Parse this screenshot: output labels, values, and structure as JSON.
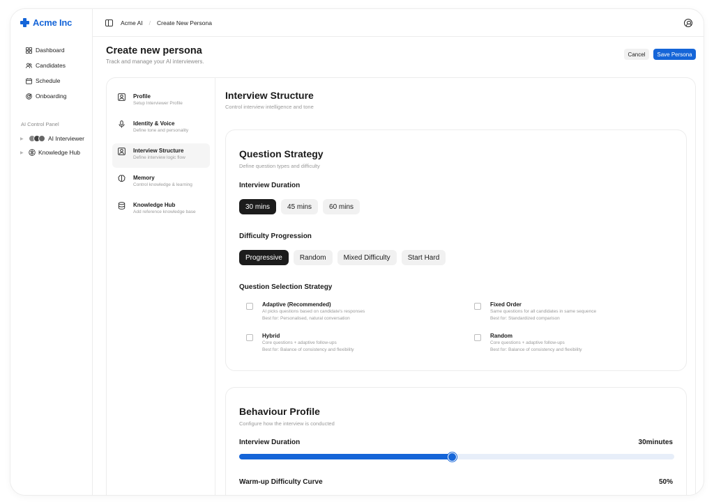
{
  "app": {
    "name": "Acme Inc"
  },
  "sidebar": {
    "nav": [
      {
        "label": "Dashboard",
        "icon": "grid-icon"
      },
      {
        "label": "Candidates",
        "icon": "users-icon"
      },
      {
        "label": "Schedule",
        "icon": "calendar-icon"
      },
      {
        "label": "Onboarding",
        "icon": "target-icon"
      }
    ],
    "panel_label": "AI Control Panel",
    "panel_items": [
      {
        "label": "AI Interviewer",
        "icon": "avatars-icon"
      },
      {
        "label": "Knowledge Hub",
        "icon": "brain-icon"
      }
    ]
  },
  "topbar": {
    "breadcrumbs": [
      "Acme AI",
      "Create New Persona"
    ]
  },
  "header": {
    "title": "Create new persona",
    "subtitle": "Track and manage your AI interviewers.",
    "cancel_label": "Cancel",
    "save_label": "Save Persona"
  },
  "steps": [
    {
      "title": "Profile",
      "desc": "Setup Interviewer Profile",
      "icon": "profile-icon",
      "active": false
    },
    {
      "title": "Identity & Voice",
      "desc": "Define tone and personality",
      "icon": "microphone-icon",
      "active": false
    },
    {
      "title": "Interview Structure",
      "desc": "Define interview logic flow",
      "icon": "structure-icon",
      "active": true
    },
    {
      "title": "Memory",
      "desc": "Control knowledge & learning",
      "icon": "brain-icon",
      "active": false
    },
    {
      "title": "Knowledge Hub",
      "desc": "Add reference knowledge base",
      "icon": "database-icon",
      "active": false
    }
  ],
  "main": {
    "title": "Interview Structure",
    "subtitle": "Control interview intelligence and tone"
  },
  "question_strategy": {
    "title": "Question Strategy",
    "subtitle": "Define question types and difficulty",
    "duration_label": "Interview Duration",
    "durations": [
      "30 mins",
      "45 mins",
      "60 mins"
    ],
    "duration_selected": "30 mins",
    "difficulty_label": "Difficulty Progression",
    "difficulties": [
      "Progressive",
      "Random",
      "Mixed Difficulty",
      "Start Hard"
    ],
    "difficulty_selected": "Progressive",
    "selection_label": "Question Selection Strategy",
    "options": [
      {
        "title": "Adaptive (Recommended)",
        "desc": "AI picks questions based on candidate's responses",
        "best": "Best for: Personalised, natural conversation",
        "checked": false
      },
      {
        "title": "Fixed Order",
        "desc": "Same questions for all candidates in same sequence",
        "best": "Best for: Standardized comparison",
        "checked": false
      },
      {
        "title": "Hybrid",
        "desc": "Core questions + adaptive follow-ups",
        "best": "Best for: Balance of consistency and flexibility",
        "checked": false
      },
      {
        "title": "Random",
        "desc": "Core questions + adaptive follow-ups",
        "best": "Best for: Balance of consistency and flexibility",
        "checked": false
      }
    ]
  },
  "behaviour_profile": {
    "title": "Behaviour Profile",
    "subtitle": "Configure how the interview is conducted",
    "duration_label": "Interview Duration",
    "duration_value": "30minutes",
    "duration_fraction": 0.49,
    "warmup_label": "Warm-up Difficulty Curve",
    "warmup_value": "50%"
  },
  "colors": {
    "accent": "#1565d8",
    "selected_pill": "#1c1c1c",
    "pill_bg": "#f1f1f1"
  }
}
